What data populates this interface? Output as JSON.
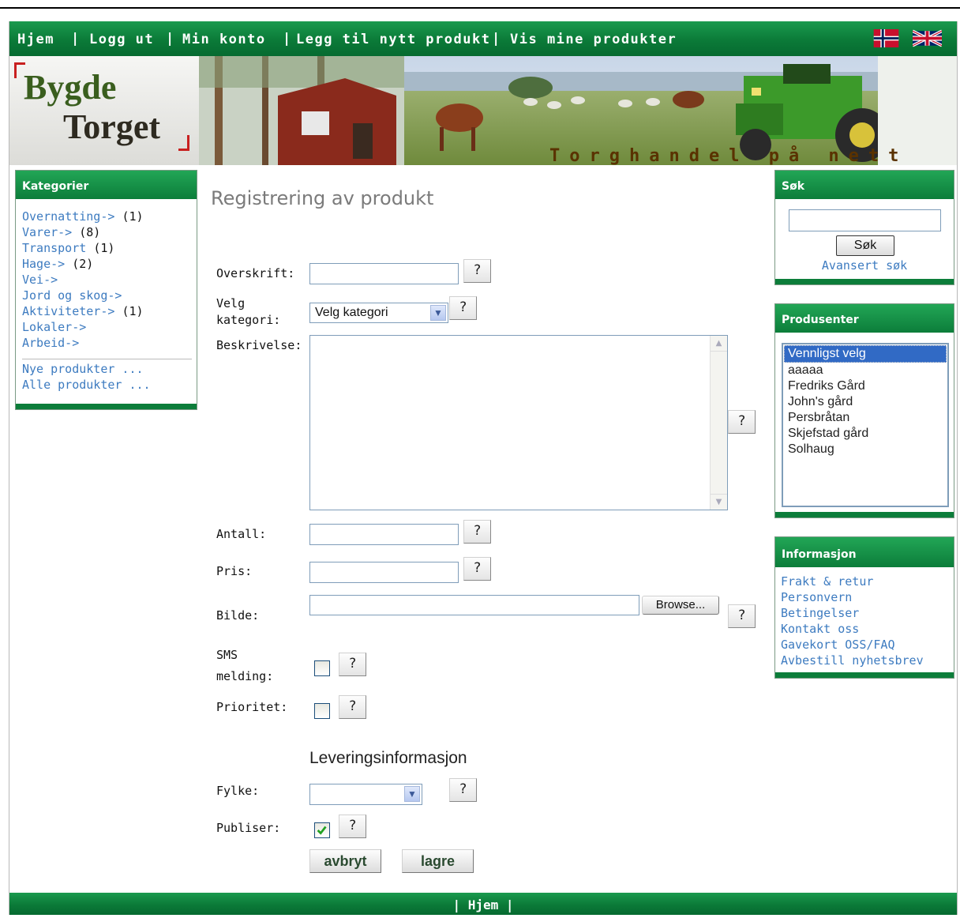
{
  "nav": {
    "items": [
      "Hjem",
      "Logg ut",
      "Min konto",
      "Legg til nytt produkt",
      "Vis mine produkter"
    ]
  },
  "banner": {
    "logo_line1": "Bygde",
    "logo_line2": "Torget",
    "tagline": "Torghandel på nett"
  },
  "categories": {
    "title": "Kategorier",
    "items": [
      {
        "label": "Overnatting->",
        "count": "(1)"
      },
      {
        "label": "Varer->",
        "count": "(8)"
      },
      {
        "label": "Transport",
        "count": "(1)"
      },
      {
        "label": "Hage->",
        "count": "(2)"
      },
      {
        "label": "Vei->",
        "count": ""
      },
      {
        "label": "Jord og skog->",
        "count": ""
      },
      {
        "label": "Aktiviteter->",
        "count": "(1)"
      },
      {
        "label": "Lokaler->",
        "count": ""
      },
      {
        "label": "Arbeid->",
        "count": ""
      }
    ],
    "new_products": "Nye produkter ...",
    "all_products": "Alle produkter ..."
  },
  "form": {
    "title": "Registrering av produkt",
    "headline_label": "Overskrift:",
    "category_label_1": "Velg",
    "category_label_2": "kategori:",
    "category_value": "Velg kategori",
    "description_label": "Beskrivelse:",
    "quantity_label": "Antall:",
    "price_label": "Pris:",
    "image_label": "Bilde:",
    "browse_label": "Browse...",
    "sms_label_1": "SMS",
    "sms_label_2": "melding:",
    "priority_label": "Prioritet:",
    "delivery_title": "Leveringsinformasjon",
    "county_label": "Fylke:",
    "county_value": "",
    "publish_label": "Publiser:",
    "publish_checked": true,
    "help_label": "?",
    "cancel_label": "avbryt",
    "save_label": "lagre"
  },
  "search": {
    "title": "Søk",
    "button_label": "Søk",
    "advanced_label": "Avansert søk"
  },
  "producers": {
    "title": "Produsenter",
    "options": [
      "Vennligst velg",
      "aaaaa",
      "Fredriks Gård",
      "John's gård",
      "Persbråtan",
      "Skjefstad gård",
      "Solhaug"
    ],
    "selected_index": 0
  },
  "info": {
    "title": "Informasjon",
    "links": [
      "Frakt & retur",
      "Personvern",
      "Betingelser",
      "Kontakt oss",
      "Gavekort OSS/FAQ",
      "Avbestill nyhetsbrev"
    ]
  },
  "footer": {
    "home_label": "Hjem"
  },
  "colors": {
    "brand_green": "#0c7d3a",
    "link_blue": "#3d7bc0"
  }
}
